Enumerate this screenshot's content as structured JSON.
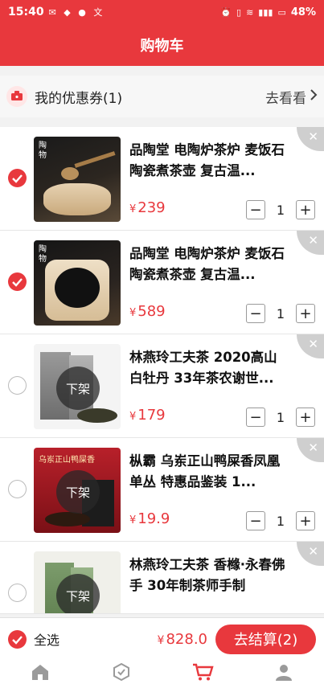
{
  "statusbar": {
    "time": "15:40",
    "battery": "48%"
  },
  "header": {
    "title": "购物车"
  },
  "coupon": {
    "label": "我的优惠券(1)",
    "link": "去看看"
  },
  "items": [
    {
      "title": "品陶堂 电陶炉茶炉 麦饭石陶瓷煮茶壶 复古温...",
      "yen": "¥",
      "price": "239",
      "qty": "1",
      "checked": true,
      "thumb_text": "陶物"
    },
    {
      "title": "品陶堂 电陶炉茶炉 麦饭石陶瓷煮茶壶 复古温...",
      "yen": "¥",
      "price": "589",
      "qty": "1",
      "checked": true,
      "thumb_text": "陶物"
    },
    {
      "title": "林燕玲工夫茶 2020高山白牡丹 33年茶农谢世...",
      "yen": "¥",
      "price": "179",
      "qty": "1",
      "checked": false,
      "off_label": "下架"
    },
    {
      "title": "枞霸 乌岽正山鸭屎香凤凰单丛 特惠品鉴装 1...",
      "yen": "¥",
      "price": "19.9",
      "qty": "1",
      "checked": false,
      "off_label": "下架",
      "thumb_text": "乌岽正山鸭屎香"
    },
    {
      "title": "林燕玲工夫茶 香橼·永春佛手 30年制茶师手制",
      "yen": "¥",
      "price": "",
      "qty": "",
      "checked": false,
      "off_label": "下架"
    }
  ],
  "footer": {
    "select_all": "全选",
    "yen": "¥",
    "total": "828.0",
    "checkout": "去结算(2)"
  },
  "tabs": [
    "home-icon",
    "category-icon",
    "cart-icon",
    "profile-icon"
  ],
  "colors": {
    "accent": "#e8383d"
  }
}
